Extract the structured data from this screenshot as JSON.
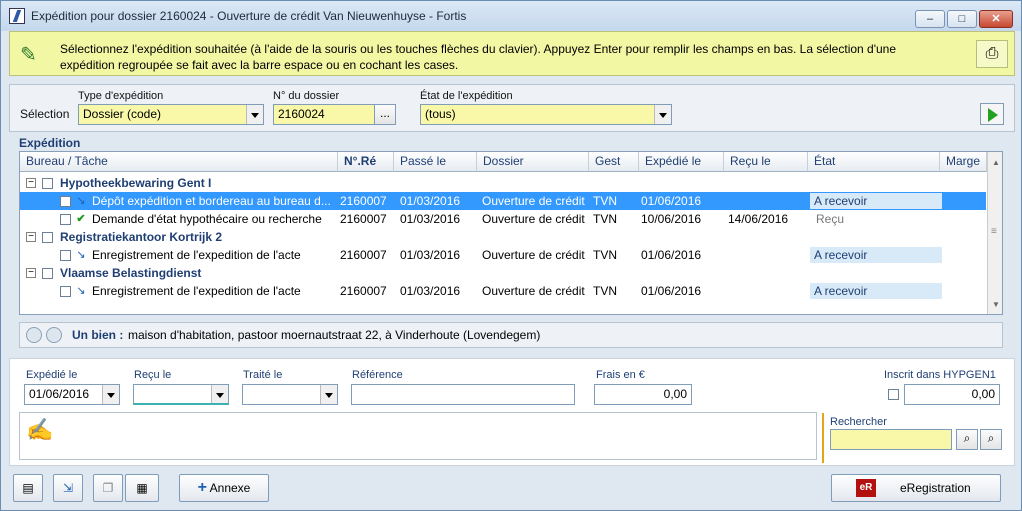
{
  "window": {
    "title": "Expédition pour dossier 2160024 - Ouverture de crédit Van Nieuwenhuyse - Fortis"
  },
  "info": {
    "text": "Sélectionnez l'expédition souhaitée (à l'aide de la souris ou les touches flèches du clavier). Appuyez Enter pour remplir les champs en bas. La sélection d'une expédition regroupée se fait avec la barre espace ou en cochant les cases."
  },
  "selection": {
    "label": "Sélection",
    "type_label": "Type d'expédition",
    "type_value": "Dossier (code)",
    "dossier_label": "N° du dossier",
    "dossier_value": "2160024",
    "browse_label": "...",
    "etat_label": "État de l'expédition",
    "etat_value": "(tous)"
  },
  "grid": {
    "title": "Expédition",
    "columns": [
      "Bureau / Tâche",
      "N°.Ré",
      "Passé le",
      "Dossier",
      "Gest",
      "Expédié le",
      "Reçu le",
      "État",
      "Marge"
    ],
    "groups": [
      {
        "name": "Hypotheekbewaring Gent I",
        "rows": [
          {
            "task": "Dépôt expédition et bordereau au bureau d...",
            "ref": "2160007",
            "passe": "01/03/2016",
            "dossier": "Ouverture de crédit",
            "gest": "TVN",
            "expedie": "01/06/2016",
            "recu": "",
            "etat": "A recevoir",
            "selected": true
          },
          {
            "task": "Demande d'état hypothécaire ou recherche",
            "ref": "2160007",
            "passe": "01/03/2016",
            "dossier": "Ouverture de crédit",
            "gest": "TVN",
            "expedie": "10/06/2016",
            "recu": "14/06/2016",
            "etat": "Reçu",
            "selected": false
          }
        ]
      },
      {
        "name": "Registratiekantoor Kortrijk 2",
        "rows": [
          {
            "task": "Enregistrement de l'expedition de l'acte",
            "ref": "2160007",
            "passe": "01/03/2016",
            "dossier": "Ouverture de crédit",
            "gest": "TVN",
            "expedie": "01/06/2016",
            "recu": "",
            "etat": "A recevoir",
            "selected": false
          }
        ]
      },
      {
        "name": "Vlaamse Belastingdienst",
        "rows": [
          {
            "task": "Enregistrement de l'expedition de l'acte",
            "ref": "2160007",
            "passe": "01/03/2016",
            "dossier": "Ouverture de crédit",
            "gest": "TVN",
            "expedie": "01/06/2016",
            "recu": "",
            "etat": "A recevoir",
            "selected": false
          }
        ]
      }
    ]
  },
  "bien": {
    "label": "Un bien :",
    "value": "maison d'habitation, pastoor moernautstraat 22, à Vinderhoute (Lovendegem)"
  },
  "form": {
    "expedie_label": "Expédié le",
    "expedie_value": "01/06/2016",
    "recu_label": "Reçu le",
    "recu_value": "",
    "traite_label": "Traité le",
    "traite_value": "",
    "reference_label": "Référence",
    "reference_value": "",
    "frais_label": "Frais en €",
    "frais_value": "0,00",
    "inscrit_label": "Inscrit dans HYPGEN1",
    "inscrit_value": "0,00",
    "rechercher_label": "Rechercher",
    "rechercher_value": ""
  },
  "buttons": {
    "annexe": "Annexe",
    "eregistration": "eRegistration",
    "eregistration_badge": "eR",
    "minimize": "–",
    "maximize": "□",
    "close": "✕"
  }
}
